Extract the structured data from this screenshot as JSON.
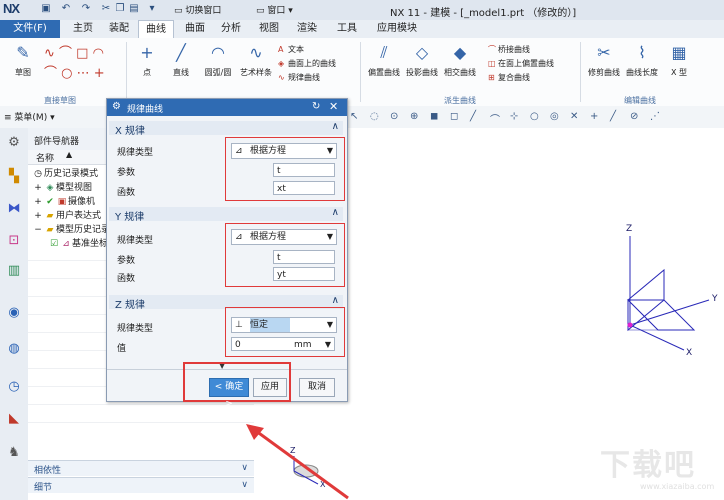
{
  "titlebar": {
    "logo": "NX",
    "switch_window": "切换窗口",
    "window_menu": "窗口",
    "title": "NX 11 - 建模 - [_model1.prt （修改的）]"
  },
  "menu_tabs": [
    "文件(F)",
    "主页",
    "装配",
    "曲线",
    "曲面",
    "分析",
    "视图",
    "渲染",
    "工具",
    "应用模块"
  ],
  "ribbon": {
    "sketch": "草图",
    "group_direct_sketch": "直接草图",
    "point": "点",
    "line": "直线",
    "arc_circle": "圆弧/圆",
    "art_spline": "艺术样条",
    "text": "文本",
    "curve_on_surface": "曲面上的曲线",
    "law_curve": "规律曲线",
    "offset_curve": "偏置曲线",
    "project_curve": "投影曲线",
    "intersect_curve": "相交曲线",
    "bridge_curve": "桥接曲线",
    "offset_on_face": "在面上偏置曲线",
    "composite_curve": "复合曲线",
    "group_derived": "派生曲线",
    "trim_curve": "修剪曲线",
    "curve_length": "曲线长度",
    "x_form": "X 型",
    "group_edit": "编辑曲线"
  },
  "toolbar": {
    "menu": "菜单(M)"
  },
  "navigator": {
    "title": "部件导航器",
    "col_name": "名称",
    "items": [
      "历史记录模式",
      "模型视图",
      "摄像机",
      "用户表达式",
      "模型历史记录",
      "基准坐标系"
    ],
    "dependency": "相依性",
    "details": "细节"
  },
  "dialog": {
    "title": "规律曲线",
    "x_section": "X 规律",
    "y_section": "Y 规律",
    "z_section": "Z 规律",
    "law_type_label": "规律类型",
    "param_label": "参数",
    "function_label": "函数",
    "value_label": "值",
    "x_type": "根据方程",
    "x_param": "t",
    "x_function": "xt",
    "y_type": "根据方程",
    "y_param": "t",
    "y_function": "yt",
    "z_type": "恒定",
    "z_value": "0",
    "z_unit": "mm",
    "ok": "< 确定 >",
    "apply": "应用",
    "cancel": "取消"
  },
  "viewport": {
    "axis_x": "X",
    "axis_y": "Y",
    "axis_z": "Z",
    "triad_z": "Z",
    "triad_x": "X"
  },
  "watermark": {
    "text": "下载吧",
    "url": "www.xiazaiba.com"
  },
  "colors": {
    "accent": "#2f6bb3",
    "highlight_red": "#e03a3a",
    "axes": "#2a2ab8"
  }
}
